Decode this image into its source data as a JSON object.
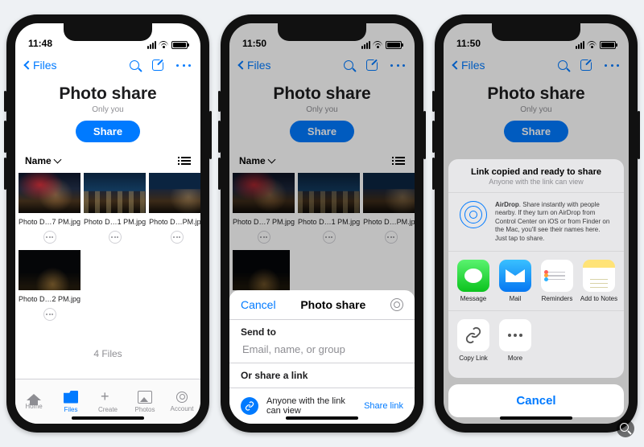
{
  "phones": {
    "a": {
      "time": "11:48"
    },
    "b": {
      "time": "11:50"
    },
    "c": {
      "time": "11:50"
    }
  },
  "nav": {
    "back": "Files"
  },
  "header": {
    "title": "Photo share",
    "subtitle": "Only you",
    "share": "Share"
  },
  "sort": {
    "label": "Name"
  },
  "files": [
    {
      "name": "Photo D…7 PM.jpg"
    },
    {
      "name": "Photo D…1 PM.jpg"
    },
    {
      "name": "Photo D…PM.jpg"
    },
    {
      "name": "Photo D…2 PM.jpg"
    }
  ],
  "count": "4 Files",
  "tabs": {
    "home": "Home",
    "files": "Files",
    "create": "Create",
    "photos": "Photos",
    "account": "Account"
  },
  "share_modal": {
    "cancel": "Cancel",
    "title": "Photo share",
    "send_to": "Send to",
    "placeholder": "Email, name, or group",
    "or": "Or share a link",
    "anyone": "Anyone with the link can view",
    "share_link": "Share link"
  },
  "ios_share": {
    "headline": "Link copied and ready to share",
    "sub": "Anyone with the link can view",
    "airdrop_label": "AirDrop",
    "airdrop_text": ". Share instantly with people nearby. If they turn on AirDrop from Control Center on iOS or from Finder on the Mac, you'll see their names here. Just tap to share.",
    "apps": {
      "message": "Message",
      "mail": "Mail",
      "reminders": "Reminders",
      "notes": "Add to Notes",
      "copy": "Copy Link",
      "more": "More"
    },
    "cancel": "Cancel"
  }
}
